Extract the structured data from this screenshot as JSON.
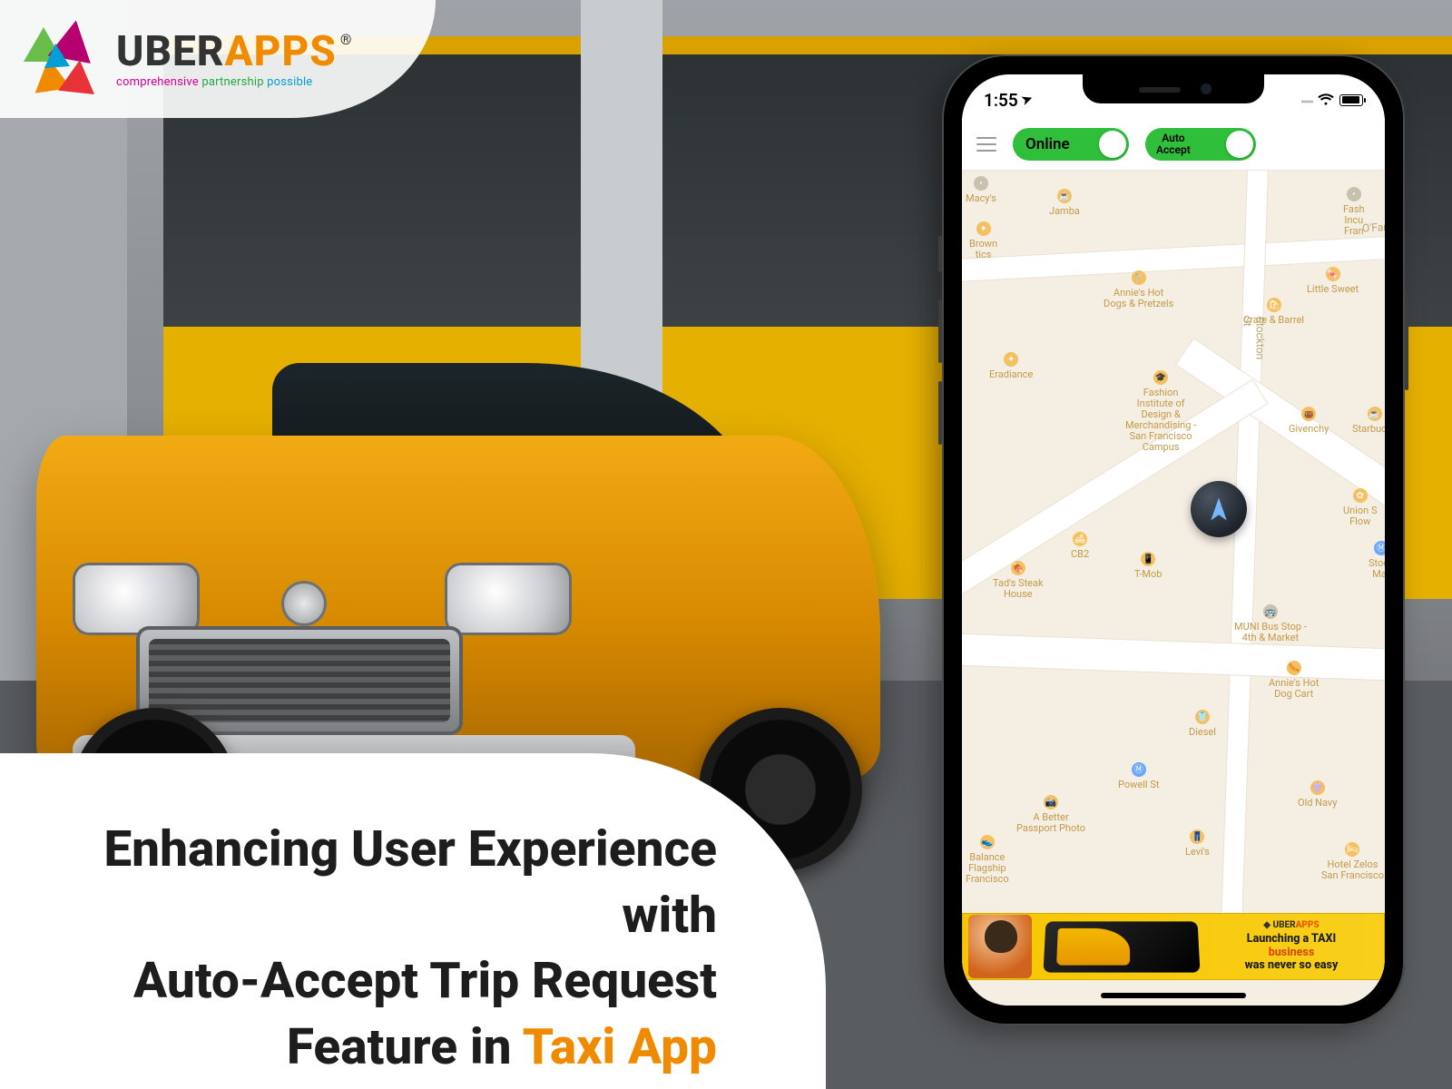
{
  "logo": {
    "uber": "UBER",
    "apps": "APPS",
    "reg": "®",
    "tagline_w1": "comprehensive",
    "tagline_w2": "partnership",
    "tagline_w3": "possible"
  },
  "headline": {
    "l1": "Enhancing User Experience with",
    "l2": "Auto-Accept Trip Request",
    "l3a": "Feature in ",
    "l3b": "Taxi App"
  },
  "phone": {
    "time": "1:55",
    "loc_glyph": "➤",
    "toggles": {
      "online": "Online",
      "auto": "Auto\nAccept"
    },
    "streets": {
      "ofarrell": "O'Farrell St",
      "stockton": "Stockton St"
    },
    "pois": {
      "macys": "Macy's",
      "jamba": "Jamba",
      "annies": "Annie's Hot\nDogs & Pretzels",
      "crate": "Crate & Barrel",
      "eradiance": "Eradiance",
      "fidm": "Fashion\nInstitute of\nDesign &\nMerchandising -\nSan Francisco\nCampus",
      "givenchy": "Givenchy",
      "starbucks": "Starbucks",
      "cb2": "CB2",
      "tads": "Tad's Steak\nHouse",
      "tmob": "T-Mob",
      "muni": "MUNI Bus Stop -\n4th & Market",
      "hotdog": "Annie's Hot\nDog Cart",
      "diesel": "Diesel",
      "powell": "Powell St",
      "passport": "A Better\nPassport Photo",
      "balance": "Balance\nFlagship\nFrancisco",
      "levis": "Levi's",
      "oldnavy": "Old Navy",
      "zelos": "Hotel Zelos\nSan Francisco",
      "littlesweet": "Little Sweet",
      "incu": "Fash\nIncu\nFran",
      "union": "Union S\nFlow",
      "stock": "Stock\nMar",
      "brown": "Brown\ntics"
    },
    "banner": {
      "brand_a": "UBER",
      "brand_b": "APPS",
      "line1": "Launching a TAXI",
      "line2": "business",
      "line3": "was never so easy"
    }
  }
}
